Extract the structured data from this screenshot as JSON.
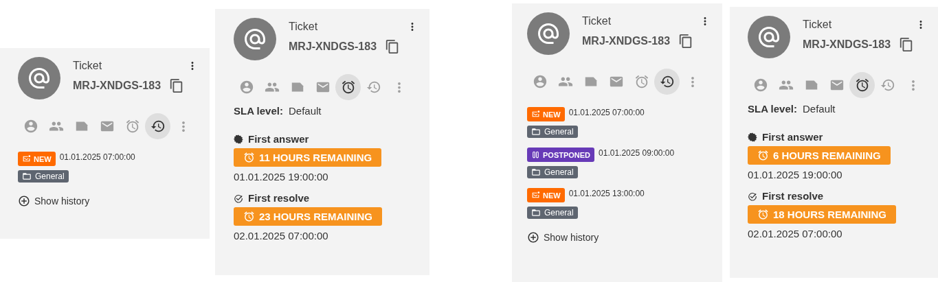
{
  "cards": [
    {
      "title": "Ticket",
      "ticket_id": "MRJ-XNDGS-183",
      "tabs": [
        {
          "kind": "customer",
          "selected": false
        },
        {
          "kind": "organization",
          "selected": false
        },
        {
          "kind": "file",
          "selected": false
        },
        {
          "kind": "mail",
          "selected": false
        },
        {
          "kind": "sla",
          "selected": false
        },
        {
          "kind": "history",
          "selected": true
        },
        {
          "kind": "more",
          "selected": false
        }
      ],
      "content": {
        "kind": "history",
        "entries": [
          {
            "kind": "new",
            "label": "NEW",
            "color": "#ff6a00",
            "time": "01.01.2025 07:00:00",
            "group": "General"
          }
        ],
        "show_history": "Show history"
      }
    },
    {
      "title": "Ticket",
      "ticket_id": "MRJ-XNDGS-183",
      "tabs": [
        {
          "kind": "customer",
          "selected": false
        },
        {
          "kind": "organization",
          "selected": false
        },
        {
          "kind": "file",
          "selected": false
        },
        {
          "kind": "mail",
          "selected": false
        },
        {
          "kind": "sla",
          "selected": true
        },
        {
          "kind": "history",
          "selected": false
        },
        {
          "kind": "more",
          "selected": false
        }
      ],
      "content": {
        "kind": "sla",
        "sla_label": "SLA level:",
        "sla_value": "Default",
        "items": [
          {
            "kind": "answer",
            "title": "First answer",
            "remaining": "11 HOURS REMAINING",
            "due": "01.01.2025 19:00:00"
          },
          {
            "kind": "resolve",
            "title": "First resolve",
            "remaining": "23 HOURS REMAINING",
            "due": "02.01.2025 07:00:00"
          }
        ]
      }
    },
    {
      "title": "Ticket",
      "ticket_id": "MRJ-XNDGS-183",
      "tabs": [
        {
          "kind": "customer",
          "selected": false
        },
        {
          "kind": "organization",
          "selected": false
        },
        {
          "kind": "file",
          "selected": false
        },
        {
          "kind": "mail",
          "selected": false
        },
        {
          "kind": "sla",
          "selected": false
        },
        {
          "kind": "history",
          "selected": true
        },
        {
          "kind": "more",
          "selected": false
        }
      ],
      "content": {
        "kind": "history",
        "entries": [
          {
            "kind": "new",
            "label": "NEW",
            "color": "#ff6a00",
            "time": "01.01.2025 07:00:00",
            "group": "General"
          },
          {
            "kind": "postponed",
            "label": "POSTPONED",
            "color": "#673ab7",
            "time": "01.01.2025 09:00:00",
            "group": "General"
          },
          {
            "kind": "new",
            "label": "NEW",
            "color": "#ff6a00",
            "time": "01.01.2025 13:00:00",
            "group": "General"
          }
        ],
        "show_history": "Show history"
      }
    },
    {
      "title": "Ticket",
      "ticket_id": "MRJ-XNDGS-183",
      "tabs": [
        {
          "kind": "customer",
          "selected": false
        },
        {
          "kind": "organization",
          "selected": false
        },
        {
          "kind": "file",
          "selected": false
        },
        {
          "kind": "mail",
          "selected": false
        },
        {
          "kind": "sla",
          "selected": true
        },
        {
          "kind": "history",
          "selected": false
        },
        {
          "kind": "more",
          "selected": false
        }
      ],
      "content": {
        "kind": "sla",
        "sla_label": "SLA level:",
        "sla_value": "Default",
        "items": [
          {
            "kind": "answer",
            "title": "First answer",
            "remaining": "6 HOURS REMAINING",
            "due": "01.01.2025 19:00:00"
          },
          {
            "kind": "resolve",
            "title": "First resolve",
            "remaining": "18 HOURS REMAINING",
            "due": "02.01.2025 07:00:00"
          }
        ]
      }
    }
  ]
}
